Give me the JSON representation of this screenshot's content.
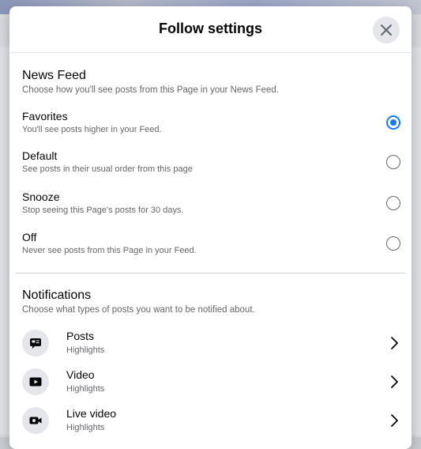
{
  "dialog": {
    "title": "Follow settings"
  },
  "news_feed": {
    "title": "News Feed",
    "subtitle": "Choose how you'll see posts from this Page in your News Feed.",
    "options": [
      {
        "label": "Favorites",
        "description": "You'll see posts higher in your Feed.",
        "selected": true
      },
      {
        "label": "Default",
        "description": "See posts in their usual order from this page",
        "selected": false
      },
      {
        "label": "Snooze",
        "description": "Stop seeing this Page's posts for 30 days.",
        "selected": false
      },
      {
        "label": "Off",
        "description": "Never see posts from this Page in your Feed.",
        "selected": false
      }
    ]
  },
  "notifications": {
    "title": "Notifications",
    "subtitle": "Choose what types of posts you want to be notified about.",
    "items": [
      {
        "label": "Posts",
        "value": "Highlights",
        "icon": "post-icon"
      },
      {
        "label": "Video",
        "value": "Highlights",
        "icon": "video-icon"
      },
      {
        "label": "Live video",
        "value": "Highlights",
        "icon": "live-video-icon"
      }
    ]
  },
  "colors": {
    "accent": "#1877f2",
    "text_primary": "#050505",
    "text_secondary": "#65676b",
    "icon_bg": "#e4e6eb"
  }
}
